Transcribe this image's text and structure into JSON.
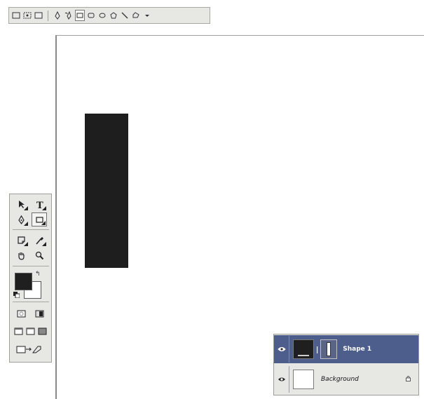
{
  "options_bar": {
    "buttons": [
      {
        "name": "shape-layers-mode-icon"
      },
      {
        "name": "paths-mode-icon"
      },
      {
        "name": "fill-pixels-mode-icon"
      },
      {
        "name": "pen-tool-icon"
      },
      {
        "name": "freeform-pen-tool-icon"
      },
      {
        "name": "rectangle-tool-icon",
        "selected": true
      },
      {
        "name": "rounded-rectangle-tool-icon"
      },
      {
        "name": "ellipse-tool-icon"
      },
      {
        "name": "polygon-tool-icon"
      },
      {
        "name": "line-tool-icon"
      },
      {
        "name": "custom-shape-tool-icon"
      },
      {
        "name": "geometry-options-dropdown-icon"
      }
    ]
  },
  "canvas": {
    "background": "#ffffff",
    "shape_color": "#1e1e1e"
  },
  "toolbox": {
    "tools": [
      {
        "name": "path-selection-tool-icon"
      },
      {
        "name": "type-tool-icon",
        "glyph": "T"
      },
      {
        "name": "pen-tool-icon"
      },
      {
        "name": "rectangle-tool-icon",
        "active": true
      },
      {
        "name": "notes-tool-icon"
      },
      {
        "name": "eyedropper-tool-icon"
      },
      {
        "name": "hand-tool-icon"
      },
      {
        "name": "zoom-tool-icon"
      }
    ],
    "foreground_color": "#1f1f1f",
    "background_color": "#ffffff"
  },
  "layers": [
    {
      "name": "Shape 1",
      "selected": true,
      "type": "shape",
      "row_color": "#4d5e8c"
    },
    {
      "name": "Background",
      "selected": false,
      "type": "background",
      "locked": true
    }
  ]
}
